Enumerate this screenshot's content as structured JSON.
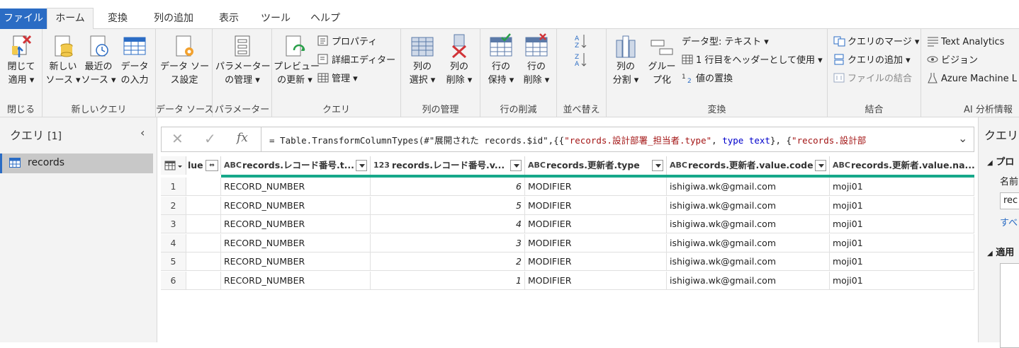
{
  "tabs": {
    "file": "ファイル",
    "home": "ホーム",
    "transform": "変換",
    "add_column": "列の追加",
    "view": "表示",
    "tools": "ツール",
    "help": "ヘルプ"
  },
  "ribbon": {
    "close": {
      "apply_l1": "閉じて",
      "apply_l2": "適用",
      "label": "閉じる"
    },
    "new_query": {
      "new_source_l1": "新しい",
      "new_source_l2": "ソース",
      "recent_l1": "最近の",
      "recent_l2": "ソース",
      "enter_l1": "データ",
      "enter_l2": "の入力",
      "label": "新しいクエリ"
    },
    "data_source": {
      "settings_l1": "データ ソー",
      "settings_l2": "ス設定",
      "label": "データ ソース"
    },
    "parameters": {
      "manage_l1": "パラメーター",
      "manage_l2": "の管理",
      "label": "パラメーター"
    },
    "query": {
      "preview_l1": "プレビュー",
      "preview_l2": "の更新",
      "properties": "プロパティ",
      "advanced_editor": "詳細エディター",
      "manage": "管理",
      "label": "クエリ"
    },
    "manage_columns": {
      "choose_l1": "列の",
      "choose_l2": "選択",
      "remove_l1": "列の",
      "remove_l2": "削除",
      "label": "列の管理"
    },
    "reduce_rows": {
      "keep_l1": "行の",
      "keep_l2": "保持",
      "remove_l1": "行の",
      "remove_l2": "削除",
      "label": "行の削減"
    },
    "sort": {
      "label": "並べ替え"
    },
    "transform": {
      "split_l1": "列の",
      "split_l2": "分割",
      "group_l1": "グルー",
      "group_l2": "プ化",
      "datatype": "データ型: テキスト",
      "header": "1 行目をヘッダーとして使用",
      "replace": "値の置換",
      "label": "変換"
    },
    "combine": {
      "merge": "クエリのマージ",
      "append": "クエリの追加",
      "files": "ファイルの結合",
      "label": "結合"
    },
    "ai": {
      "text": "Text Analytics",
      "vision": "ビジョン",
      "azure": "Azure Machine L",
      "label": "AI 分析情報"
    }
  },
  "left": {
    "title": "クエリ",
    "count": "[1]",
    "query_name": "records"
  },
  "formula": {
    "fx": "fx",
    "text_prefix": "= Table.TransformColumnTypes(#\"展開された records.$id\",{{",
    "str1": "\"records.設計部署_担当者.type\"",
    "comma1": ", ",
    "kw": "type text",
    "close1": "}, {",
    "str2": "\"records.設計部"
  },
  "grid": {
    "partial_header": "lue",
    "headers": [
      {
        "type": "ABC",
        "name": "records.レコード番号.t..."
      },
      {
        "type": "123",
        "name": "records.レコード番号.v..."
      },
      {
        "type": "ABC",
        "name": "records.更新者.type"
      },
      {
        "type": "ABC",
        "name": "records.更新者.value.code"
      },
      {
        "type": "ABC",
        "name": "records.更新者.value.na..."
      }
    ],
    "rows": [
      {
        "n": "1",
        "c1": "RECORD_NUMBER",
        "c2": "6",
        "c3": "MODIFIER",
        "c4": "ishigiwa.wk@gmail.com",
        "c5": "moji01"
      },
      {
        "n": "2",
        "c1": "RECORD_NUMBER",
        "c2": "5",
        "c3": "MODIFIER",
        "c4": "ishigiwa.wk@gmail.com",
        "c5": "moji01"
      },
      {
        "n": "3",
        "c1": "RECORD_NUMBER",
        "c2": "4",
        "c3": "MODIFIER",
        "c4": "ishigiwa.wk@gmail.com",
        "c5": "moji01"
      },
      {
        "n": "4",
        "c1": "RECORD_NUMBER",
        "c2": "3",
        "c3": "MODIFIER",
        "c4": "ishigiwa.wk@gmail.com",
        "c5": "moji01"
      },
      {
        "n": "5",
        "c1": "RECORD_NUMBER",
        "c2": "2",
        "c3": "MODIFIER",
        "c4": "ishigiwa.wk@gmail.com",
        "c5": "moji01"
      },
      {
        "n": "6",
        "c1": "RECORD_NUMBER",
        "c2": "1",
        "c3": "MODIFIER",
        "c4": "ishigiwa.wk@gmail.com",
        "c5": "moji01"
      }
    ]
  },
  "right": {
    "title": "クエリ",
    "props": "プロ",
    "name_label": "名前",
    "name_value": "rec",
    "all_link": "すべ",
    "applied": "適用"
  },
  "colors": {
    "accent": "#2b6cc4",
    "teal": "#17a88a"
  }
}
